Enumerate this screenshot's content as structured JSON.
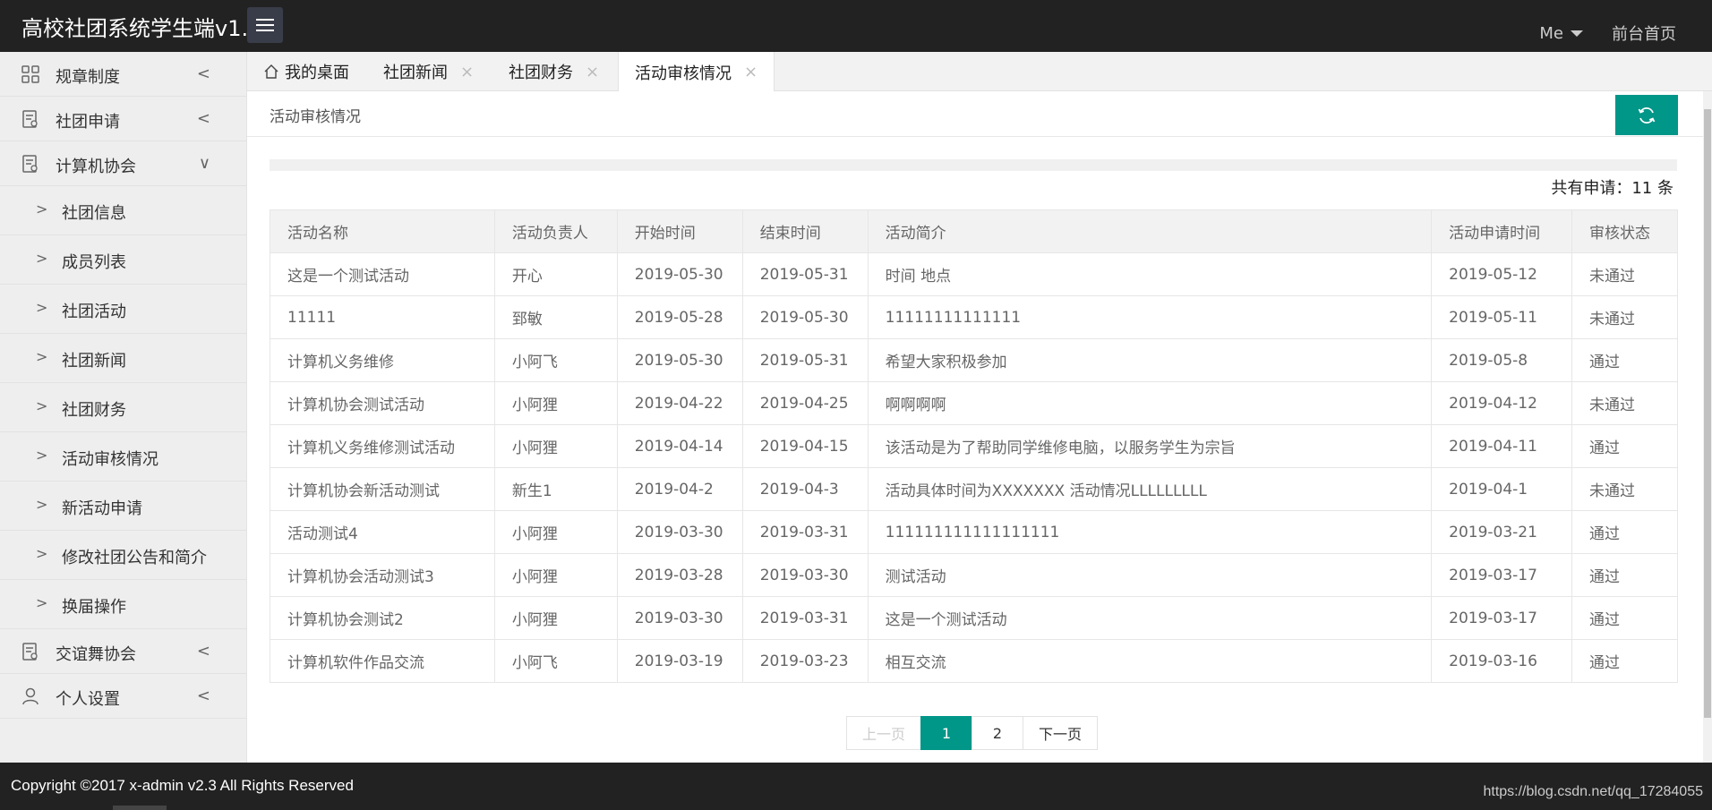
{
  "header": {
    "title": "高校社团系统学生端v1.0",
    "user_menu": "Me",
    "home_link": "前台首页"
  },
  "sidebar": {
    "items": [
      {
        "label": "规章制度",
        "icon": "grid-icon",
        "arrow": "<"
      },
      {
        "label": "社团申请",
        "icon": "document-icon",
        "arrow": "<"
      },
      {
        "label": "计算机协会",
        "icon": "document-icon",
        "arrow": "∨"
      }
    ],
    "subitems": [
      {
        "label": "社团信息"
      },
      {
        "label": "成员列表"
      },
      {
        "label": "社团活动"
      },
      {
        "label": "社团新闻"
      },
      {
        "label": "社团财务"
      },
      {
        "label": "活动审核情况"
      },
      {
        "label": "新活动申请"
      },
      {
        "label": "修改社团公告和简介"
      },
      {
        "label": "换届操作"
      }
    ],
    "bottom_items": [
      {
        "label": "交谊舞协会",
        "icon": "document-icon",
        "arrow": "<"
      },
      {
        "label": "个人设置",
        "icon": "user-icon",
        "arrow": "<"
      }
    ],
    "sub_arrow": ">"
  },
  "tabs": [
    {
      "label": "我的桌面",
      "closable": false
    },
    {
      "label": "社团新闻",
      "closable": true
    },
    {
      "label": "社团财务",
      "closable": true
    },
    {
      "label": "活动审核情况",
      "closable": true,
      "active": true
    }
  ],
  "tab_close": "×",
  "breadcrumb": "活动审核情况",
  "total": "共有申请：11 条",
  "table": {
    "headers": [
      "活动名称",
      "活动负责人",
      "开始时间",
      "结束时间",
      "活动简介",
      "活动申请时间",
      "审核状态"
    ],
    "rows": [
      [
        "这是一个测试活动",
        "开心",
        "2019-05-30",
        "2019-05-31",
        "时间 地点",
        "2019-05-12",
        "未通过"
      ],
      [
        "11111",
        "郅敏",
        "2019-05-28",
        "2019-05-30",
        "11111111111111",
        "2019-05-11",
        "未通过"
      ],
      [
        "计算机义务维修",
        "小阿飞",
        "2019-05-30",
        "2019-05-31",
        "希望大家积极参加",
        "2019-05-8",
        "通过"
      ],
      [
        "计算机协会测试活动",
        "小阿狸",
        "2019-04-22",
        "2019-04-25",
        "啊啊啊啊",
        "2019-04-12",
        "未通过"
      ],
      [
        "计算机义务维修测试活动",
        "小阿狸",
        "2019-04-14",
        "2019-04-15",
        "该活动是为了帮助同学维修电脑，以服务学生为宗旨",
        "2019-04-11",
        "通过"
      ],
      [
        "计算机协会新活动测试",
        "新生1",
        "2019-04-2",
        "2019-04-3",
        "活动具体时间为XXXXXXX 活动情况LLLLLLLLL",
        "2019-04-1",
        "未通过"
      ],
      [
        "活动测试4",
        "小阿狸",
        "2019-03-30",
        "2019-03-31",
        "111111111111111111",
        "2019-03-21",
        "通过"
      ],
      [
        "计算机协会活动测试3",
        "小阿狸",
        "2019-03-28",
        "2019-03-30",
        "测试活动",
        "2019-03-17",
        "通过"
      ],
      [
        "计算机协会测试2",
        "小阿狸",
        "2019-03-30",
        "2019-03-31",
        "这是一个测试活动",
        "2019-03-17",
        "通过"
      ],
      [
        "计算机软件作品交流",
        "小阿飞",
        "2019-03-19",
        "2019-03-23",
        "相互交流",
        "2019-03-16",
        "通过"
      ]
    ]
  },
  "pagination": {
    "prev": "上一页",
    "pages": [
      "1",
      "2"
    ],
    "current": "1",
    "next": "下一页"
  },
  "footer": {
    "copyright": "Copyright ©2017 x-admin v2.3 All Rights Reserved",
    "watermark": "https://blog.csdn.net/qq_17284055"
  },
  "colors": {
    "accent": "#009688",
    "header_bg": "#222222",
    "sidebar_bg": "#eeeeee"
  }
}
